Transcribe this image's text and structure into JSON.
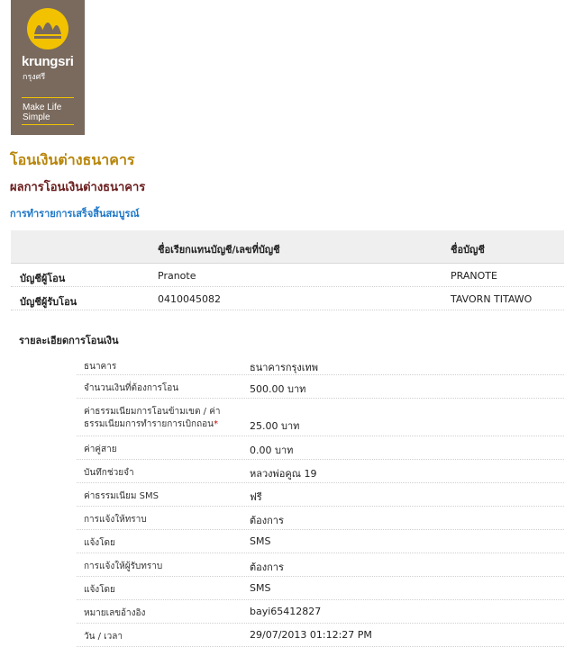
{
  "logo": {
    "brand": "krungsri",
    "brand_thai": "กรุงศรี",
    "tagline_1": "Make Life",
    "tagline_2": "Simple",
    "colors": {
      "background": "#7a6a5d",
      "accent": "#f2c200"
    }
  },
  "page": {
    "title": "โอนเงินต่างธนาคาร",
    "subtitle": "ผลการโอนเงินต่างธนาคาร",
    "status": "การทำรายการเสร็จสิ้นสมบูรณ์"
  },
  "accounts": {
    "headers": [
      "",
      "ชื่อเรียกแทนบัญชี/เลขที่บัญชี",
      "ชื่อบัญชี"
    ],
    "rows": [
      [
        "บัญชีผู้โอน",
        "Pranote",
        "PRANOTE"
      ],
      [
        "บัญชีผู้รับโอน",
        "0410045082",
        "TAVORN TITAWO"
      ]
    ]
  },
  "details": {
    "title": "รายละเอียดการโอนเงิน",
    "rows": [
      {
        "label": "ธนาคาร",
        "value": "ธนาคารกรุงเทพ"
      },
      {
        "label": "จำนวนเงินที่ต้องการโอน",
        "value": "500.00 บาท"
      },
      {
        "label_line1": "ค่าธรรมเนียมการโอนข้ามเขต / ค่า",
        "label_line2": "ธรรมเนียมการทำรายการเบิกถอน",
        "required_mark": "*",
        "value": "25.00 บาท"
      },
      {
        "label": "ค่าคู่สาย",
        "value": "0.00 บาท"
      },
      {
        "label": "บันทึกช่วยจำ",
        "value": "หลวงพ่อคูณ 19"
      },
      {
        "label": "ค่าธรรมเนียม SMS",
        "value": "ฟรี"
      },
      {
        "label": "การแจ้งให้ทราบ",
        "value": "ต้องการ"
      },
      {
        "label": "แจ้งโดย",
        "value": "SMS"
      },
      {
        "label": "การแจ้งให้ผู้รับทราบ",
        "value": "ต้องการ"
      },
      {
        "label": "แจ้งโดย",
        "value": "SMS"
      },
      {
        "label": "หมายเลขอ้างอิง",
        "value": "bayi65412827"
      },
      {
        "label": "วัน / เวลา",
        "value": "29/07/2013 01:12:27 PM"
      }
    ]
  },
  "colors": {
    "title": "#b8860b",
    "subtitle": "#6b1d1d",
    "status": "#1e78c8",
    "table_header_bg": "#efefef"
  }
}
